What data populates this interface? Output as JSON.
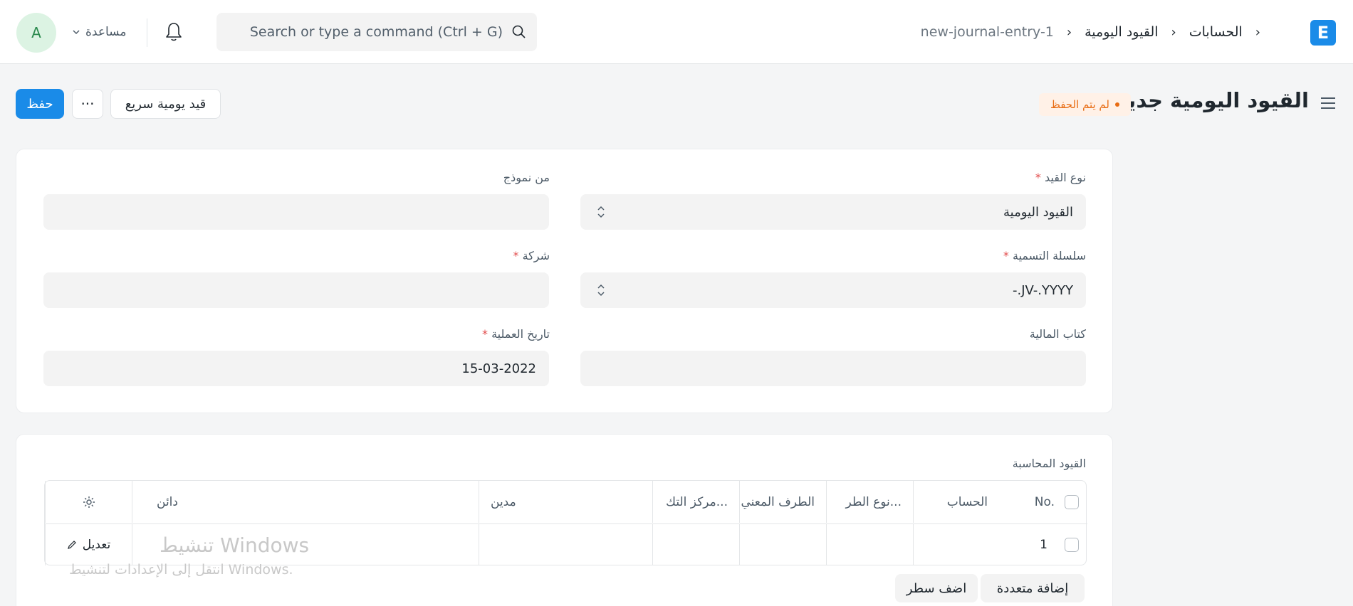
{
  "navbar": {
    "avatar_initial": "A",
    "help_label": "مساعدة",
    "search_placeholder": "Search or type a command (Ctrl + G)",
    "breadcrumbs": [
      "الحسابات",
      "القيود اليومية",
      "new-journal-entry-1"
    ],
    "logo_letter": "E"
  },
  "page": {
    "title": "القيود اليومية جديد",
    "status": "لم يتم الحفظ",
    "save_label": "حفظ",
    "more_label": "···",
    "quick_entry_label": "قيد يومية سريع"
  },
  "form": {
    "entry_type": {
      "label": "نوع القيد",
      "value": "القيود اليومية"
    },
    "from_template": {
      "label": "من نموذج",
      "value": ""
    },
    "naming_series": {
      "label": "سلسلة التسمية",
      "value": "-.JV-.YYYY"
    },
    "company": {
      "label": "شركة",
      "value": ""
    },
    "finance_book": {
      "label": "كتاب المالية",
      "value": ""
    },
    "posting_date": {
      "label": "تاريخ العملية",
      "value": "15-03-2022"
    }
  },
  "accounts_table": {
    "label": "القيود المحاسبة",
    "columns": [
      "No.",
      "الحساب",
      "نوع الطر...",
      "الطرف المعني",
      "مركز التك...",
      "مدين",
      "دائن"
    ],
    "rows": [
      {
        "no": "1"
      }
    ],
    "edit_label": "تعديل",
    "add_multiple_label": "إضافة متعددة",
    "add_row_label": "اضف سطر"
  },
  "watermark": {
    "line1": "تنشيط Windows",
    "line2": "انتقل إلى الإعدادات لتنشيط Windows."
  },
  "colors": {
    "primary": "#1a8be8",
    "indicator": "#e86c13",
    "required": "#e24c4c"
  }
}
